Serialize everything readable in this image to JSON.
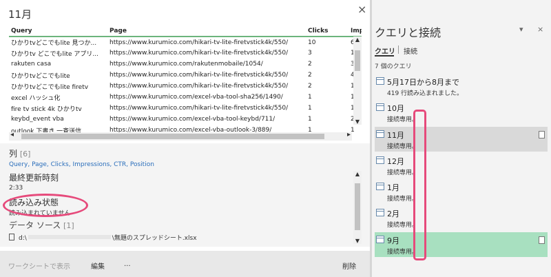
{
  "peek": {
    "title": "11月",
    "close": "×",
    "columns": [
      "Query",
      "Page",
      "Clicks",
      "Imp"
    ],
    "rows": [
      [
        "ひかりtvどこでもlite 見つか...",
        "https://www.kurumico.com/hikari-tv-lite-firetvstick4k/550/",
        "10",
        "6"
      ],
      [
        "ひかりtv どこでもlite アプリ...",
        "https://www.kurumico.com/hikari-tv-lite-firetvstick4k/550/",
        "3",
        "1"
      ],
      [
        "rakuten casa",
        "https://www.kurumico.com/rakutenmobaile/1054/",
        "2",
        "3"
      ],
      [
        "ひかりtvどこでもlite",
        "https://www.kurumico.com/hikari-tv-lite-firetvstick4k/550/",
        "2",
        "4"
      ],
      [
        "ひかりtvどこでもlite firetv",
        "https://www.kurumico.com/hikari-tv-lite-firetvstick4k/550/",
        "2",
        "1"
      ],
      [
        "excel ハッシュ化",
        "https://www.kurumico.com/excel-vba-tool-sha256/1490/",
        "1",
        "1"
      ],
      [
        "fire tv stick 4k ひかりtv",
        "https://www.kurumico.com/hikari-tv-lite-firetvstick4k/550/",
        "1",
        "1"
      ],
      [
        "keybd_event vba",
        "https://www.kurumico.com/excel-vba-tool-keybd/711/",
        "1",
        "2"
      ],
      [
        "outlook 下書き 一斉送信",
        "https://www.kurumico.com/excel-vba-outlook-3/889/",
        "1",
        "1"
      ]
    ],
    "details": {
      "columns_heading": "列",
      "columns_count": "[6]",
      "columns_list": "Query, Page, Clicks, Impressions, CTR, Position",
      "updated_heading": "最終更新時刻",
      "updated_value": "2:33",
      "load_heading": "読み込み状態",
      "load_value": "読み込まれていません",
      "source_heading": "データ ソース",
      "source_count": "[1]",
      "source_prefix": "d:\\",
      "source_suffix": "\\無題のスプレッドシート.xlsx"
    },
    "footer": {
      "view_sheet": "ワークシートで表示",
      "edit": "編集",
      "more": "...",
      "delete": "削除"
    }
  },
  "pane": {
    "title": "クエリと接続",
    "minimize": "▾",
    "close": "×",
    "tab_queries": "クエリ",
    "tab_connections": "接続",
    "query_count": "7 個のクエリ",
    "queries": [
      {
        "name": "5月17日から8月まで",
        "status": "419 行読み込まれました。"
      },
      {
        "name": "10月",
        "status": "接続専用。"
      },
      {
        "name": "11月",
        "status": "接続専用。"
      },
      {
        "name": "12月",
        "status": "接続専用。"
      },
      {
        "name": "1月",
        "status": "接続専用。"
      },
      {
        "name": "2月",
        "status": "接続専用。"
      },
      {
        "name": "9月",
        "status": "接続専用。"
      }
    ]
  },
  "colors": {
    "header_rule": "#6cb47c",
    "selected_item": "#d9d9d9",
    "highlight_item": "#a8e0c0",
    "annotation": "#e64a7b",
    "link": "#2a6ebb"
  }
}
